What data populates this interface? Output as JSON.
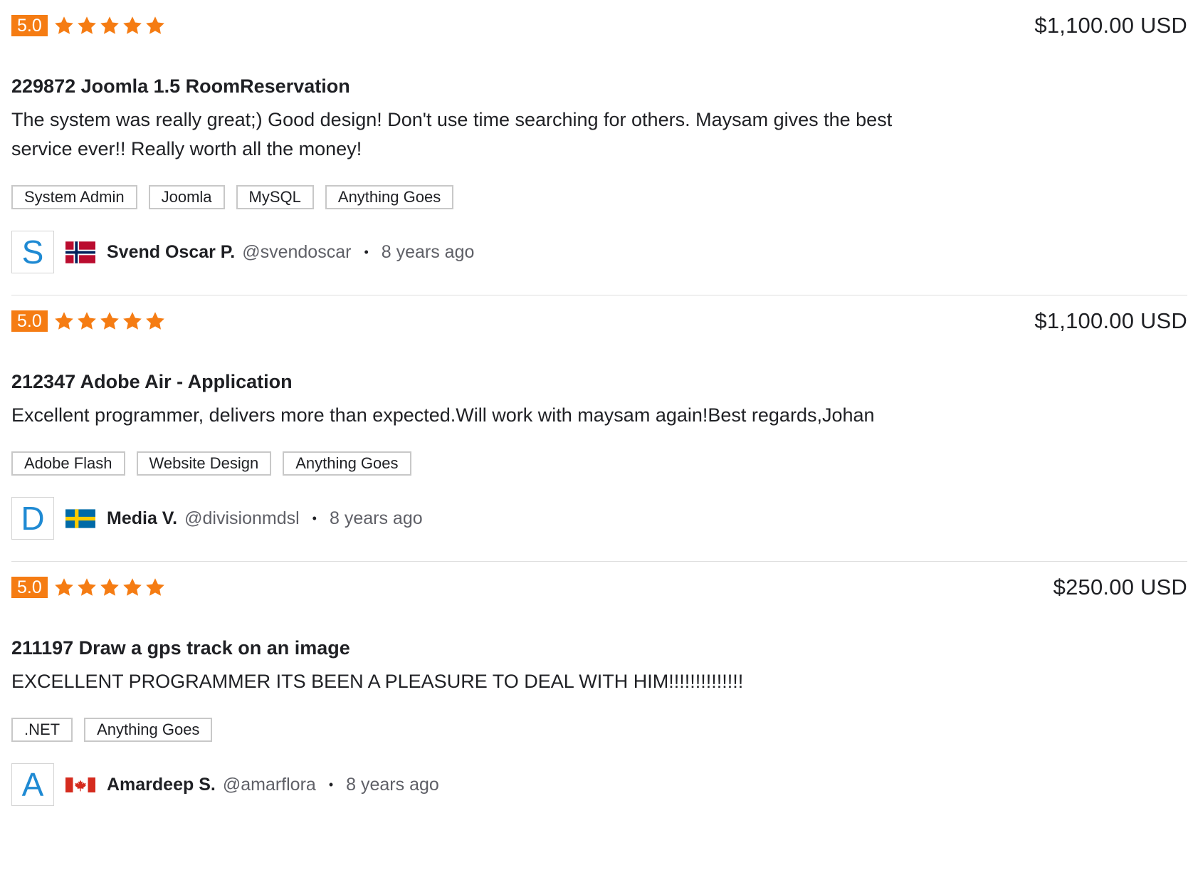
{
  "reviews": [
    {
      "rating": "5.0",
      "stars": 5,
      "price": "$1,100.00 USD",
      "project_title": "229872 Joomla 1.5 RoomReservation",
      "comment": "The system was really great;) Good design! Don't use time searching for others. Maysam gives the best service ever!! Really worth all the money!",
      "tags": [
        "System Admin",
        "Joomla",
        "MySQL",
        "Anything Goes"
      ],
      "reviewer": {
        "avatar_letter": "S",
        "flag": "norway-flag-icon",
        "name": "Svend Oscar P.",
        "handle": "@svendoscar",
        "time_ago": "8 years ago"
      }
    },
    {
      "rating": "5.0",
      "stars": 5,
      "price": "$1,100.00 USD",
      "project_title": "212347 Adobe Air - Application",
      "comment": "Excellent programmer, delivers more than expected.Will work with maysam again!Best regards,Johan",
      "tags": [
        "Adobe Flash",
        "Website Design",
        "Anything Goes"
      ],
      "reviewer": {
        "avatar_letter": "D",
        "flag": "sweden-flag-icon",
        "name": "Media V.",
        "handle": "@divisionmdsl",
        "time_ago": "8 years ago"
      }
    },
    {
      "rating": "5.0",
      "stars": 5,
      "price": "$250.00 USD",
      "project_title": "211197 Draw a gps track on an image",
      "comment": "EXCELLENT PROGRAMMER ITS BEEN A PLEASURE TO DEAL WITH HIM!!!!!!!!!!!!!!",
      "tags": [
        ".NET",
        "Anything Goes"
      ],
      "reviewer": {
        "avatar_letter": "A",
        "flag": "canada-flag-icon",
        "name": "Amardeep S.",
        "handle": "@amarflora",
        "time_ago": "8 years ago"
      }
    }
  ],
  "colors": {
    "accent": "#f57c13",
    "avatar_letter": "#1f8ad3",
    "text": "#1f2024",
    "muted": "#5f6067",
    "border": "#c8c8c8"
  },
  "separator": "•"
}
